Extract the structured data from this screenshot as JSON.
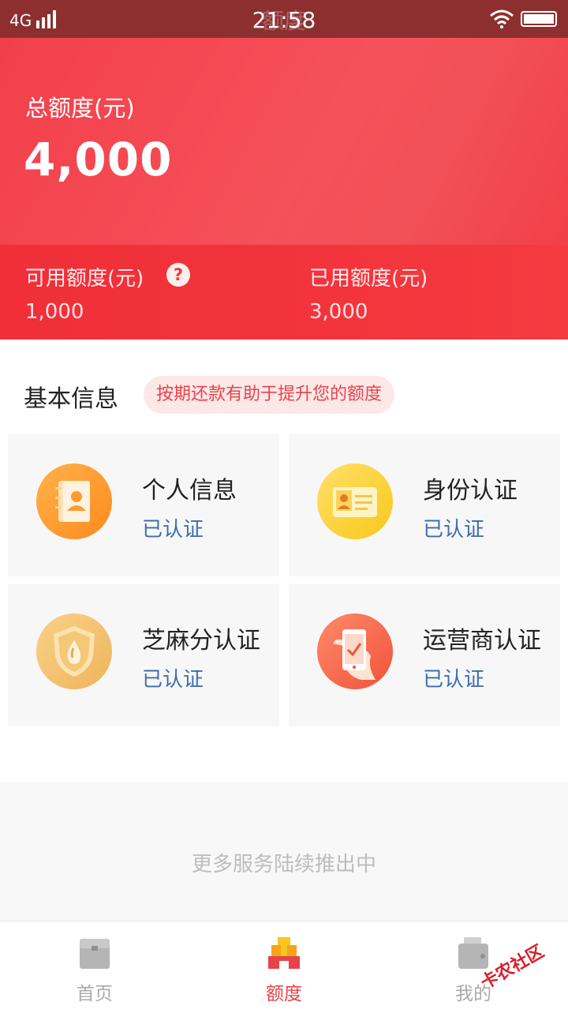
{
  "status_bar": {
    "network": "4G",
    "time": "21:58",
    "page_title": "额度"
  },
  "hero": {
    "total_label": "总额度(元)",
    "total_value": "4,000",
    "available_label": "可用额度(元)",
    "available_value": "1,000",
    "used_label": "已用额度(元)",
    "used_value": "3,000",
    "help_icon": "question-circle-icon"
  },
  "basic_info": {
    "title": "基本信息",
    "tip": "按期还款有助于提升您的额度",
    "cards": [
      {
        "title": "个人信息",
        "status": "已认证",
        "icon": "contacts-book-icon"
      },
      {
        "title": "身份认证",
        "status": "已认证",
        "icon": "id-card-icon"
      },
      {
        "title": "芝麻分认证",
        "status": "已认证",
        "icon": "shield-drop-icon"
      },
      {
        "title": "运营商认证",
        "status": "已认证",
        "icon": "phone-check-icon"
      }
    ]
  },
  "more": {
    "text": "更多服务陆续推出中"
  },
  "tabbar": {
    "items": [
      {
        "label": "首页",
        "icon": "home-chest-icon",
        "active": false
      },
      {
        "label": "额度",
        "icon": "quota-bars-icon",
        "active": true
      },
      {
        "label": "我的",
        "icon": "wallet-icon",
        "active": false
      }
    ]
  },
  "watermark": "卡农社区",
  "colors": {
    "accent": "#e8434a",
    "hero_red": "#f2404b",
    "status_blue": "#3a6fb0"
  }
}
